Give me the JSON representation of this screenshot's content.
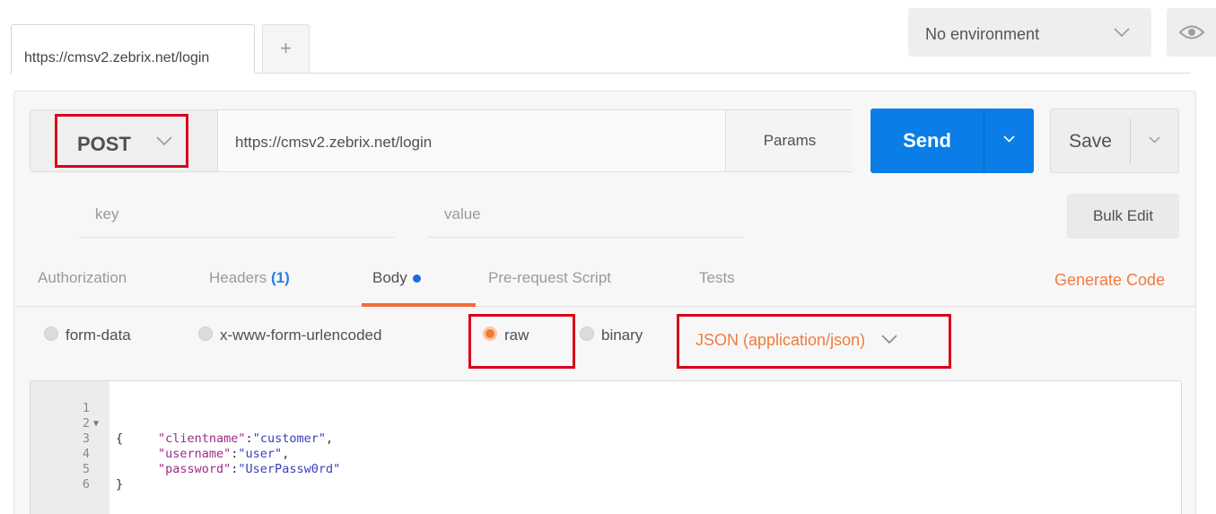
{
  "tabs": {
    "active_tab_label": "https://cmsv2.zebrix.net/login",
    "new_tab_label": "+"
  },
  "environment": {
    "selected": "No environment"
  },
  "request": {
    "method": "POST",
    "url": "https://cmsv2.zebrix.net/login",
    "params_label": "Params",
    "send_label": "Send",
    "save_label": "Save"
  },
  "key_value": {
    "key_placeholder": "key",
    "value_placeholder": "value",
    "bulk_edit_label": "Bulk Edit"
  },
  "section_tabs": [
    {
      "label": "Authorization"
    },
    {
      "label": "Headers",
      "count": "(1)"
    },
    {
      "label": "Body"
    },
    {
      "label": "Pre-request Script"
    },
    {
      "label": "Tests"
    }
  ],
  "generate_code_label": "Generate Code",
  "body_types": [
    {
      "label": "form-data",
      "selected": false
    },
    {
      "label": "x-www-form-urlencoded",
      "selected": false
    },
    {
      "label": "raw",
      "selected": true
    },
    {
      "label": "binary",
      "selected": false
    }
  ],
  "content_type": "JSON (application/json)",
  "editor": {
    "line_numbers": [
      "1",
      "2",
      "3",
      "4",
      "5",
      "6"
    ],
    "lines": [
      {
        "text": "{"
      },
      {
        "key": "\"clientname\"",
        "sep": ":",
        "value": "\"customer\"",
        "end": ","
      },
      {
        "key": "\"username\"",
        "sep": ":",
        "value": "\"user\"",
        "end": ","
      },
      {
        "key": "\"password\"",
        "sep": ":",
        "value": "\"UserPassw0rd\"",
        "end": ""
      },
      {
        "text": "}"
      },
      {
        "text": ""
      }
    ]
  },
  "colors": {
    "send_button": "#0b7de6",
    "active_tab_underline": "#f26b3a",
    "accent_orange": "#f07b3f",
    "highlight_red": "#d9001b",
    "json_key": "#9c2b8a",
    "json_string": "#3b3fb8"
  }
}
